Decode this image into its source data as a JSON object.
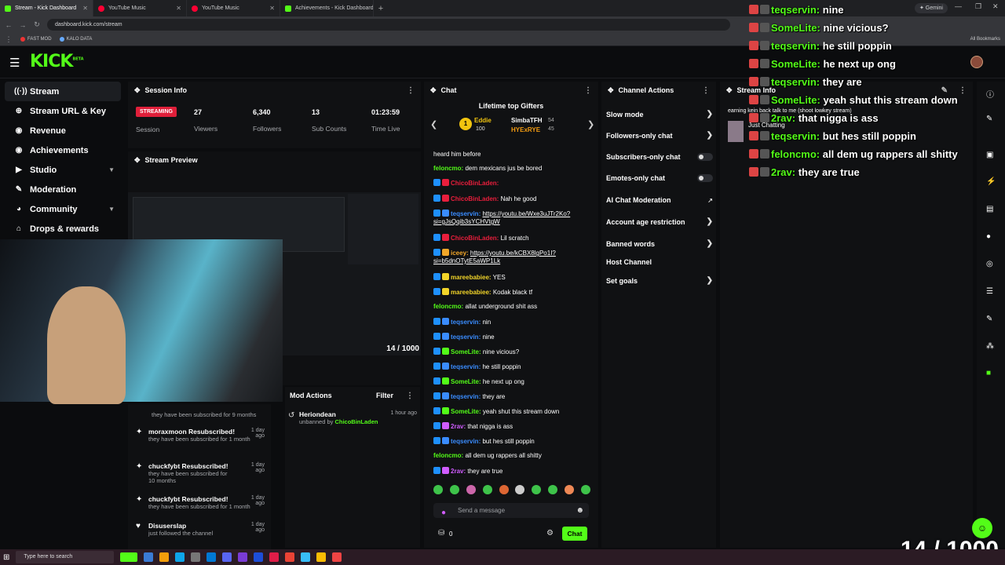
{
  "browser": {
    "tabs": [
      {
        "title": "Stream - Kick Dashboard",
        "color": "#53fc18",
        "active": true
      },
      {
        "title": "YouTube Music",
        "color": "#ff0033",
        "active": false
      },
      {
        "title": "YouTube Music",
        "color": "#ff0033",
        "active": false
      },
      {
        "title": "Achievements - Kick Dashboard",
        "color": "#53fc18",
        "active": false
      }
    ],
    "new_tab": "+",
    "gemini": "✦ Gemini",
    "url": "dashboard.kick.com/stream",
    "bookmarks": [
      "FAST MOD",
      "KALO DATA"
    ],
    "all_bookmarks": "All Bookmarks"
  },
  "brand": {
    "logo": "KICK",
    "beta": "BETA",
    "accent": "#53fc18"
  },
  "sidebar": {
    "items": [
      {
        "label": "Stream",
        "icon": "broadcast-icon",
        "glyph": "((·))"
      },
      {
        "label": "Stream URL & Key",
        "icon": "key-icon",
        "glyph": "⊕"
      },
      {
        "label": "Revenue",
        "icon": "coin-icon",
        "glyph": "◉"
      },
      {
        "label": "Achievements",
        "icon": "trophy-icon",
        "glyph": "◉"
      },
      {
        "label": "Studio",
        "icon": "studio-icon",
        "glyph": "▶"
      },
      {
        "label": "Moderation",
        "icon": "wrench-icon",
        "glyph": "✎"
      },
      {
        "label": "Community",
        "icon": "users-icon",
        "glyph": "◕"
      },
      {
        "label": "Drops & rewards",
        "icon": "gift-icon",
        "glyph": "⌂"
      }
    ]
  },
  "session": {
    "title": "Session Info",
    "status": "STREAMING",
    "status_label": "Session",
    "stats": [
      {
        "value": "27",
        "label": "Viewers"
      },
      {
        "value": "6,340",
        "label": "Followers"
      },
      {
        "value": "13",
        "label": "Sub Counts"
      },
      {
        "value": "01:23:59",
        "label": "Time Live"
      }
    ]
  },
  "preview": {
    "title": "Stream Preview",
    "counter": "14 / 1000"
  },
  "mod_actions": {
    "title": "Mod Actions",
    "filter": "Filter",
    "entry": {
      "user": "Heriondean",
      "time": "1 hour ago",
      "text": "unbanned by",
      "by": "ChicoBinLaden"
    }
  },
  "activity": [
    {
      "name": "",
      "sub": "they have been subscribed for 9 months",
      "time": ""
    },
    {
      "name": "moraxmoon Resubscribed!",
      "sub": "they have been subscribed for 1 month",
      "time": "1 day ago"
    },
    {
      "name": "chuckfybt Resubscribed!",
      "sub": "they have been subscribed for 10 months",
      "time": "1 day ago"
    },
    {
      "name": "chuckfybt Resubscribed!",
      "sub": "they have been subscribed for 1 month",
      "time": "1 day ago"
    },
    {
      "name": "Disuserslap",
      "sub": "just followed the channel",
      "time": "1 day ago"
    }
  ],
  "chat": {
    "title": "Chat",
    "gifters_title": "Lifetime top Gifters",
    "gifters": [
      {
        "name": "Eddie",
        "count": "100",
        "rank": "1"
      },
      {
        "name": "SimbaTFH",
        "count": "54"
      },
      {
        "name": "HYExRYE",
        "count": "45"
      }
    ],
    "messages": [
      {
        "user": "",
        "text": "heard him before",
        "color": "#ffffff"
      },
      {
        "user": "feloncmo:",
        "text": "dem mexicans jus be bored",
        "color": "#53fc18"
      },
      {
        "user": "ChicoBinLaden:",
        "text": "",
        "color": "#e91e3c"
      },
      {
        "user": "ChicoBinLaden:",
        "text": "Nah he good",
        "color": "#e91e3c"
      },
      {
        "user": "teqservin:",
        "text": "https://youtu.be/Wxe3uJTr2Ko?si=gJsQqib3sYCHVtgW",
        "color": "#3a8cff",
        "link": true
      },
      {
        "user": "ChicoBinLaden:",
        "text": "Lil scratch",
        "color": "#e91e3c"
      },
      {
        "user": "iceey:",
        "text": "https://youtu.be/kCBX8lgPo1I?si=b5dnOTytE5aWP1Lk",
        "color": "#f1a629",
        "link": true
      },
      {
        "user": "mareebabiee:",
        "text": "YES",
        "color": "#f1d429"
      },
      {
        "user": "mareebabiee:",
        "text": "Kodak black tf",
        "color": "#f1d429"
      },
      {
        "user": "feloncmo:",
        "text": "allat underground shit ass",
        "color": "#53fc18"
      },
      {
        "user": "teqservin:",
        "text": "nin",
        "color": "#3a8cff"
      },
      {
        "user": "teqservin:",
        "text": "nine",
        "color": "#3a8cff"
      },
      {
        "user": "SomeLite:",
        "text": "nine vicious?",
        "color": "#53fc18"
      },
      {
        "user": "teqservin:",
        "text": "he still poppin",
        "color": "#3a8cff"
      },
      {
        "user": "SomeLite:",
        "text": "he next up ong",
        "color": "#53fc18"
      },
      {
        "user": "teqservin:",
        "text": "they are",
        "color": "#3a8cff"
      },
      {
        "user": "SomeLite:",
        "text": "yeah shut this stream down",
        "color": "#53fc18"
      },
      {
        "user": "2rav:",
        "text": "that nigga is ass",
        "color": "#d05cff"
      },
      {
        "user": "teqservin:",
        "text": "but hes still poppin",
        "color": "#3a8cff"
      },
      {
        "user": "feloncmo:",
        "text": "all dem ug rappers all shitty",
        "color": "#53fc18"
      },
      {
        "user": "2rav:",
        "text": "they are true",
        "color": "#d05cff"
      }
    ],
    "placeholder": "Send a message",
    "points": "0",
    "send": "Chat"
  },
  "channel_actions": {
    "title": "Channel Actions",
    "items": [
      {
        "label": "Slow mode",
        "control": "arrow"
      },
      {
        "label": "Followers-only chat",
        "control": "arrow"
      },
      {
        "label": "Subscribers-only chat",
        "control": "toggle"
      },
      {
        "label": "Emotes-only chat",
        "control": "toggle"
      },
      {
        "label": "AI Chat Moderation",
        "control": "external"
      },
      {
        "label": "Account age restriction",
        "control": "arrow"
      },
      {
        "label": "Banned words",
        "control": "arrow"
      },
      {
        "label": "Host Channel",
        "control": "none"
      },
      {
        "label": "Set goals",
        "control": "arrow"
      }
    ]
  },
  "stream_info": {
    "title": "Stream Info",
    "stream_title": "earning kein back talk to me (shoot lowkey stream)",
    "category": "Just Chatting"
  },
  "overlay": {
    "messages": [
      {
        "user": "teqservin:",
        "text": "nine"
      },
      {
        "user": "SomeLite:",
        "text": "nine vicious?"
      },
      {
        "user": "teqservin:",
        "text": "he still poppin"
      },
      {
        "user": "SomeLite:",
        "text": "he next up ong"
      },
      {
        "user": "teqservin:",
        "text": "they are"
      },
      {
        "user": "SomeLite:",
        "text": "yeah shut this stream down"
      },
      {
        "user": "2rav:",
        "text": "that nigga is ass"
      },
      {
        "user": "teqservin:",
        "text": "but hes still poppin"
      },
      {
        "user": "feloncmo:",
        "text": "all dem ug rappers all shitty"
      },
      {
        "user": "2rav:",
        "text": "they are true"
      }
    ],
    "counter": "14 / 1000"
  },
  "taskbar": {
    "search": "Type here to search"
  }
}
